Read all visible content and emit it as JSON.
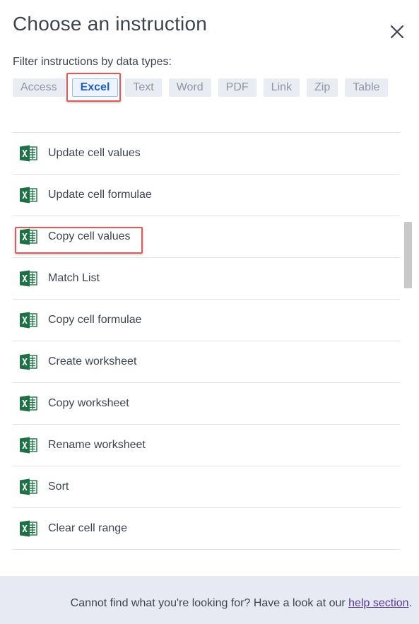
{
  "dialog": {
    "title": "Choose an instruction",
    "filter_label": "Filter instructions by data types:"
  },
  "filters": [
    {
      "label": "Access",
      "active": false
    },
    {
      "label": "Excel",
      "active": true
    },
    {
      "label": "Text",
      "active": false
    },
    {
      "label": "Word",
      "active": false
    },
    {
      "label": "PDF",
      "active": false
    },
    {
      "label": "Link",
      "active": false
    },
    {
      "label": "Zip",
      "active": false
    },
    {
      "label": "Table",
      "active": false
    }
  ],
  "instructions": [
    {
      "label": "Update cell values",
      "icon": "excel-icon"
    },
    {
      "label": "Update cell formulae",
      "icon": "excel-icon"
    },
    {
      "label": "Copy cell values",
      "icon": "excel-icon",
      "highlighted": true
    },
    {
      "label": "Match List",
      "icon": "excel-icon"
    },
    {
      "label": "Copy cell formulae",
      "icon": "excel-icon"
    },
    {
      "label": "Create worksheet",
      "icon": "excel-icon"
    },
    {
      "label": "Copy worksheet",
      "icon": "excel-icon"
    },
    {
      "label": "Rename worksheet",
      "icon": "excel-icon"
    },
    {
      "label": "Sort",
      "icon": "excel-icon"
    },
    {
      "label": "Clear cell range",
      "icon": "excel-icon"
    }
  ],
  "footer": {
    "text": "Cannot find what you're looking for? Have a look at our ",
    "link_text": "help section",
    "suffix": "."
  },
  "colors": {
    "excel_green": "#1e7145",
    "highlight_red": "#e05a5a",
    "active_chip_text": "#1e5fbf",
    "footer_bg": "#e7eaf3"
  }
}
